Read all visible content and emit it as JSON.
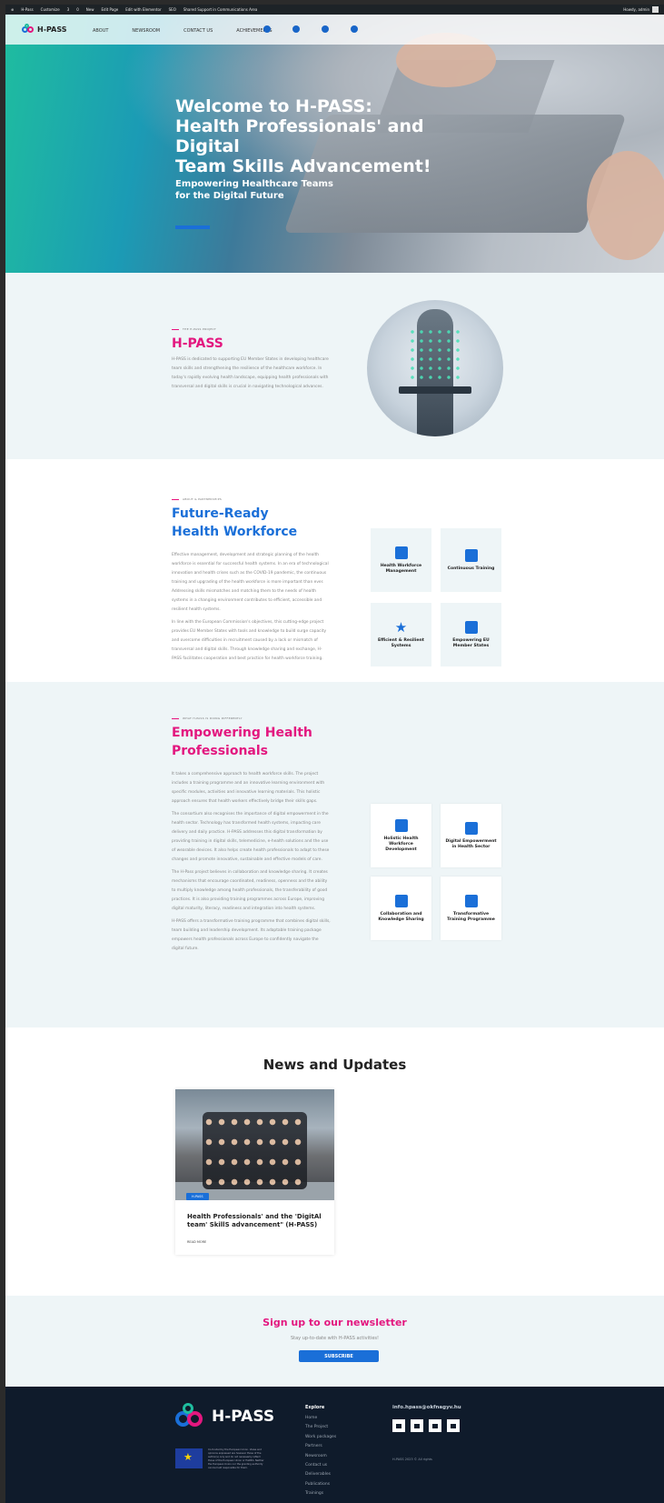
{
  "admin_bar": {
    "items": [
      "H-Pass",
      "Customize",
      "3",
      "0",
      "New",
      "Edit Page",
      "Edit with Elementor",
      "SEO",
      "Shared Support in Communications Area"
    ],
    "howdy": "Howdy, admin"
  },
  "nav": {
    "brand": "H-PASS",
    "links": [
      "ABOUT",
      "NEWSROOM",
      "CONTACT US",
      "ACHIEVEMENTS"
    ],
    "icons": [
      "facebook-icon",
      "youtube-icon",
      "instagram-icon",
      "twitter-icon"
    ]
  },
  "hero": {
    "title_line1": "Welcome to H-PASS:",
    "title_line2": "Health Professionals' and Digital",
    "title_line3": "Team Skills Advancement!",
    "subtitle_line1": "Empowering Healthcare Teams",
    "subtitle_line2": "for the Digital Future"
  },
  "about": {
    "eyebrow": "THE H-PASS PROJECT",
    "title": "H-PASS",
    "body": "H-PASS is dedicated to supporting EU Member States in developing healthcare team skills and strengthening the resilience of the healthcare workforce. In today's rapidly evolving health landscape, equipping health professionals with transversal and digital skills is crucial in navigating technological advances."
  },
  "workforce": {
    "eyebrow": "ABOUT & PARTNERSHIPS",
    "title_line1": "Future-Ready",
    "title_line2": "Health Workforce",
    "body1": "Effective management, development and strategic planning of the health workforce is essential for successful health systems. In an era of technological innovation and health crises such as the COVID-19 pandemic, the continuous training and upgrading of the health workforce is more important than ever. Addressing skills mismatches and matching them to the needs of health systems in a changing environment contributes to efficient, accessible and resilient health systems.",
    "body2": "In line with the European Commission's objectives, this cutting-edge project provides EU Member States with tools and knowledge to build surge capacity and overcome difficulties in recruitment caused by a lack or mismatch of transversal and digital skills. Through knowledge sharing and exchange, H-PASS facilitates cooperation and best practice for health workforce training.",
    "cards": [
      "Health Workforce Management",
      "Continuous Training",
      "Efficient & Resilient Systems",
      "Empowering EU Member States"
    ]
  },
  "empowering": {
    "eyebrow": "WHAT H-PASS IS DOING DIFFERENTLY",
    "title_line1": "Empowering Health",
    "title_line2": "Professionals",
    "body1": "It takes a comprehensive approach to health workforce skills. The project includes a training programme and an innovative learning environment with specific modules, activities and innovative learning materials. This holistic approach ensures that health workers effectively bridge their skills gaps.",
    "body2": "The consortium also recognises the importance of digital empowerment in the health sector. Technology has transformed health systems, impacting care delivery and daily practice. H-PASS addresses this digital transformation by providing training in digital skills, telemedicine, e-health solutions and the use of wearable devices. It also helps create health professionals to adapt to these changes and promote innovative, sustainable and effective models of care.",
    "body3": "The H-Pass project believes in collaboration and knowledge sharing. It creates mechanisms that encourage coordinated, readiness, openness and the ability to multiply knowledge among health professionals, the transferability of good practices. It is also providing training programmes across Europe, improving digital maturity, literacy, readiness and integration into health systems.",
    "body4": "H-PASS offers a transformative training programme that combines digital skills, team building and leadership development. Its adaptable training package empowers health professionals across Europe to confidently navigate the digital future.",
    "cards": [
      "Holistic Health Workforce Development",
      "Digital Empowerment in Health Sector",
      "Collaboration and Knowledge Sharing",
      "Transformative Training Programme"
    ]
  },
  "news": {
    "heading": "News and Updates",
    "card": {
      "badge": "H-PASS",
      "title": "Health Professionals' and the 'DigitAl team' SkillS advancement\" (H-PASS)",
      "more": "READ MORE"
    }
  },
  "newsletter": {
    "heading": "Sign up to our newsletter",
    "text": "Stay up-to-date with H-PASS activities!",
    "button": "SUBSCRIBE"
  },
  "footer": {
    "brand": "H-PASS",
    "eu_text": "Co-funded by the European Union. Views and opinions expressed are however those of the author(s) only and do not necessarily reflect those of the European Union or HaDEA. Neither the European Union nor the granting authority can be held responsible for them.",
    "explore_title": "Explore",
    "explore_links": [
      "Home",
      "The Project",
      "Work packages",
      "Partners",
      "Newsroom",
      "Contact us",
      "Deliverables",
      "Publications",
      "Trainings"
    ],
    "email": "info.hpass@okfnagyv.hu",
    "social": [
      "linkedin-icon",
      "youtube-icon",
      "instagram-icon",
      "twitter-icon"
    ],
    "copyright": "H-PASS 2023 © All rights"
  },
  "colors": {
    "brand_blue": "#1a6fd8",
    "brand_pink": "#e3177f",
    "footer_bg": "#0f1b2b",
    "light_bg": "#eef5f7"
  }
}
